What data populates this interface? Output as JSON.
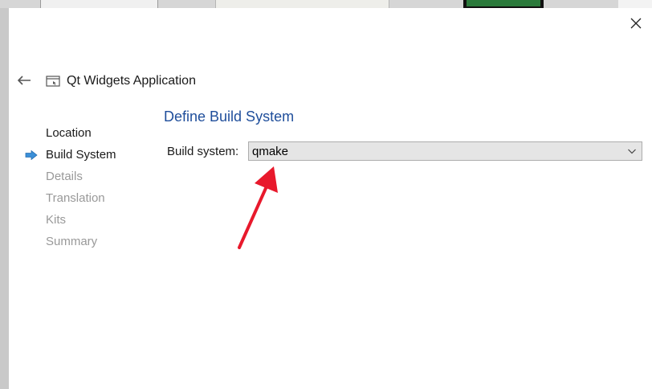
{
  "dialog": {
    "title": "Qt Widgets Application",
    "icons": {
      "close": "close-icon",
      "back": "arrow-left-icon",
      "app": "window-icon",
      "current_step": "arrow-right-icon"
    }
  },
  "steps": [
    {
      "label": "Location",
      "state": "done"
    },
    {
      "label": "Build System",
      "state": "current"
    },
    {
      "label": "Details",
      "state": "pending"
    },
    {
      "label": "Translation",
      "state": "pending"
    },
    {
      "label": "Kits",
      "state": "pending"
    },
    {
      "label": "Summary",
      "state": "pending"
    }
  ],
  "page": {
    "title": "Define Build System",
    "build_system_label": "Build system:",
    "build_system_value": "qmake"
  },
  "colors": {
    "title_blue": "#1f4e9b",
    "annotation_red": "#e8192c",
    "step_marker_blue": "#3a8fd8",
    "inactive_text": "#999999"
  }
}
